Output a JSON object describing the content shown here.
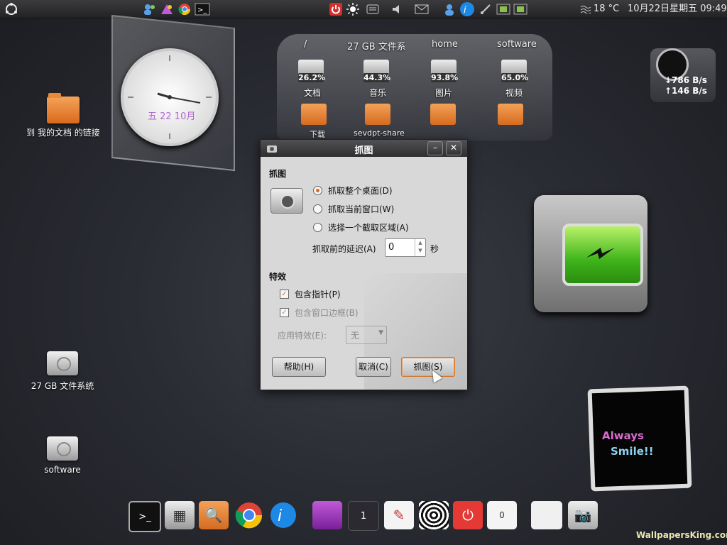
{
  "top_panel": {
    "weather": "18 °C",
    "datetime": "10月22日星期五 09:49"
  },
  "desktop_icons": [
    {
      "label": "到 我的文档 的链接"
    },
    {
      "label": "27 GB 文件系统"
    },
    {
      "label": "software"
    }
  ],
  "clock_widget": {
    "date": "五 22 10月"
  },
  "places_widget": {
    "headers": [
      "/",
      "27 GB 文件系",
      "home",
      "software"
    ],
    "disks": [
      {
        "percent": "26.2%",
        "label": "文档"
      },
      {
        "percent": "44.3%",
        "label": "音乐"
      },
      {
        "percent": "93.8%",
        "label": "图片"
      },
      {
        "percent": "65.0%",
        "label": "视频"
      }
    ],
    "folders": [
      {
        "label": "下载"
      },
      {
        "label": "sevdpt-share"
      },
      {
        "label": ""
      },
      {
        "label": ""
      }
    ]
  },
  "net_widget": {
    "down": "↓786 B/s",
    "up": "↑146 B/s"
  },
  "smile_widget": {
    "line1": "Always",
    "line2": "Smile!!"
  },
  "dock": {
    "workspace_num": "1",
    "counter": "0"
  },
  "dialog": {
    "title": "抓图",
    "section1": "抓图",
    "options": [
      {
        "label": "抓取整个桌面(D)",
        "selected": true
      },
      {
        "label": "抓取当前窗口(W)",
        "selected": false
      },
      {
        "label": "选择一个截取区域(A)",
        "selected": false
      }
    ],
    "delay_label": "抓取前的延迟(A)",
    "delay_value": "0",
    "delay_unit": "秒",
    "section2": "特效",
    "include_pointer": "包含指针(P)",
    "include_border": "包含窗口边框(B)",
    "apply_effect": "应用特效(E):",
    "effect_value": "无",
    "buttons": {
      "help": "帮助(H)",
      "cancel": "取消(C)",
      "capture": "抓图(S)"
    }
  },
  "watermark": "WallpapersKing.com",
  "colors": {
    "accent": "#d86a1e",
    "panel": "#2b2b2d"
  }
}
